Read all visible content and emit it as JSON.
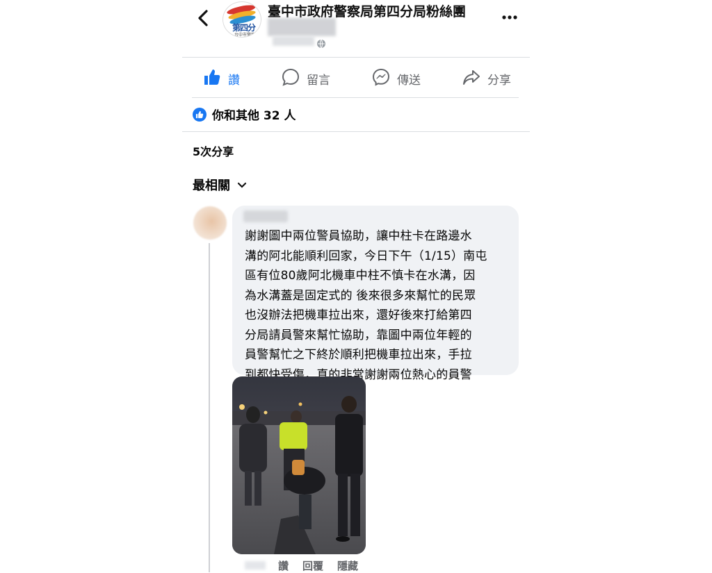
{
  "header": {
    "page_name": "臺中市政府警察局第四分局粉絲團",
    "avatar_logo_text": "第四分",
    "avatar_logo_sub": "台中市警察局"
  },
  "actions": {
    "like": "讚",
    "comment": "留言",
    "send": "傳送",
    "share": "分享"
  },
  "reactions": {
    "summary": "你和其他 32 人"
  },
  "shares": {
    "text": "5次分享"
  },
  "sort": {
    "label": "最相關"
  },
  "comment": {
    "text": "謝謝圖中兩位警員協助，讓中柱卡在路邊水\n溝的阿北能順利回家，今日下午（1/15）南屯\n區有位80歲阿北機車中柱不慎卡在水溝，因\n為水溝蓋是固定式的 後來很多來幫忙的民眾\n也沒辦法把機車拉出來，還好後來打給第四\n分局請員警來幫忙協助，靠圖中兩位年輕的\n員警幫忙之下終於順利把機車拉出來，手拉\n到都快受傷，真的非常謝謝兩位熱心的員警",
    "actions": {
      "like": "讚",
      "reply": "回覆",
      "hide": "隱藏"
    }
  },
  "colors": {
    "accent": "#1877f2",
    "secondary_text": "#65676b",
    "bubble": "#f0f2f5"
  }
}
